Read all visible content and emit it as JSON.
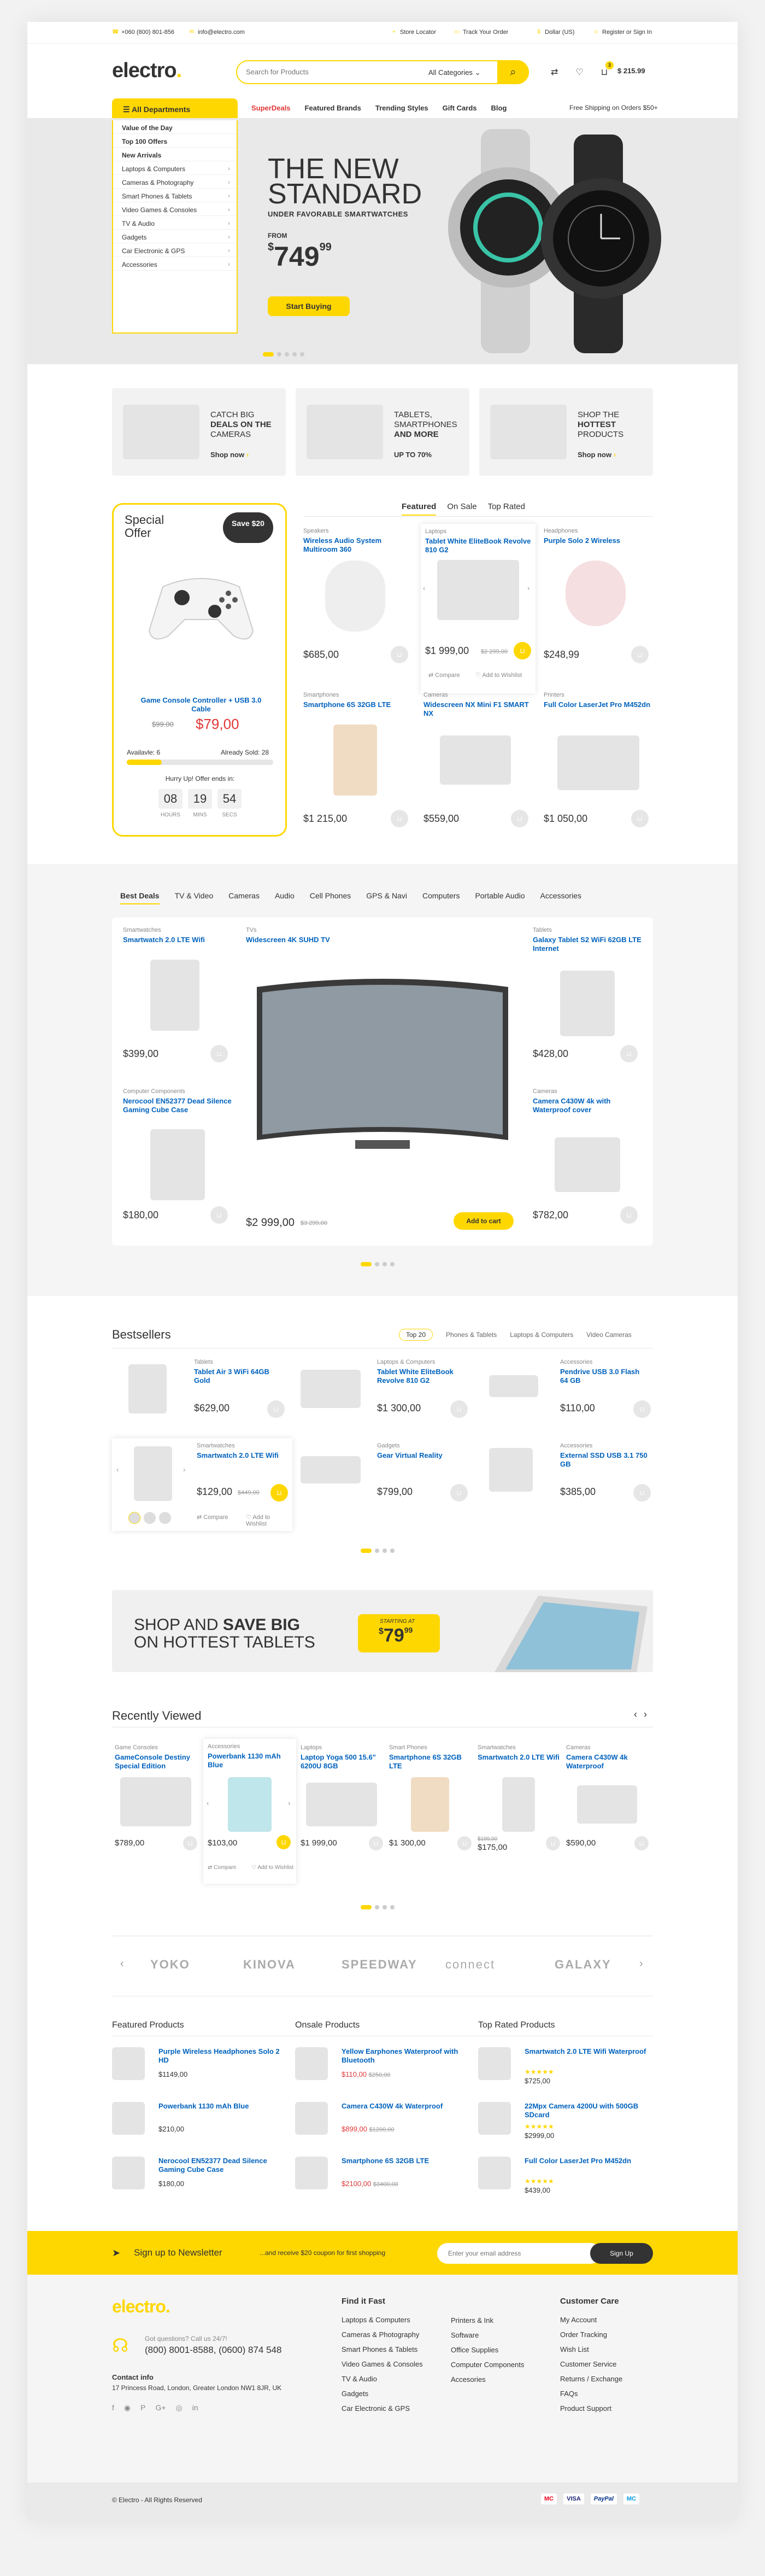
{
  "topbar": {
    "phone": "+060 (800) 801-856",
    "email": "info@electro.com",
    "store_locator": "Store Locator",
    "track_order": "Track Your Order",
    "currency": "Dollar (US)",
    "register": "Register or Sign In"
  },
  "header": {
    "logo": "electro",
    "search_placeholder": "Search for Products",
    "search_category": "All Categories",
    "cart_count": "3",
    "cart_total": "$ 215.99"
  },
  "nav": {
    "all_departments": "All Departments",
    "items": [
      "SuperDeals",
      "Featured Brands",
      "Trending Styles",
      "Gift Cards",
      "Blog"
    ],
    "free_shipping": "Free Shipping on Orders $50+"
  },
  "categories": [
    "Value of the Day",
    "Top 100 Offers",
    "New Arrivals",
    "Laptops & Computers",
    "Cameras & Photography",
    "Smart Phones & Tablets",
    "Video Games & Consoles",
    "TV & Audio",
    "Gadgets",
    "Car Electronic & GPS",
    "Accessories"
  ],
  "hero": {
    "title1": "THE NEW",
    "title2": "STANDARD",
    "subtitle": "UNDER FAVORABLE SMARTWATCHES",
    "from": "FROM",
    "price": "749",
    "price_cents": "99",
    "button": "Start Buying"
  },
  "promos": [
    {
      "l1": "CATCH BIG",
      "l2": "DEALS ON THE",
      "l3": "CAMERAS",
      "shop": "Shop now"
    },
    {
      "l1": "TABLETS,",
      "l2": "SMARTPHONES",
      "l3": "AND MORE",
      "shop": "UP TO 70%"
    },
    {
      "l1": "SHOP THE",
      "l2": "HOTTEST",
      "l3": "PRODUCTS",
      "shop": "Shop now"
    }
  ],
  "special": {
    "title": "Special Offer",
    "save": "Save $20",
    "name": "Game Console Controller + USB 3.0 Cable",
    "old_price": "$99.00",
    "price": "$79,00",
    "available": "Availavle: 6",
    "sold": "Already Sold: 28",
    "hurry": "Hurry Up! Offer ends in:",
    "hours": "08",
    "mins": "19",
    "secs": "54",
    "hours_l": "HOURS",
    "mins_l": "MINS",
    "secs_l": "SECS"
  },
  "featured_tabs": [
    "Featured",
    "On Sale",
    "Top Rated"
  ],
  "featured": [
    {
      "cat": "Speakers",
      "name": "Wireless Audio System Multiroom 360",
      "price": "$685,00"
    },
    {
      "cat": "Laptops",
      "name": "Tablet White EliteBook Revolve 810 G2",
      "price": "$1 999,00",
      "old": "$2 299,00"
    },
    {
      "cat": "Headphones",
      "name": "Purple Solo 2 Wireless",
      "price": "$248,99"
    },
    {
      "cat": "Smartphones",
      "name": "Smartphone 6S 32GB LTE",
      "price": "$1 215,00"
    },
    {
      "cat": "Cameras",
      "name": "Widescreen NX Mini F1 SMART NX",
      "price": "$559,00"
    },
    {
      "cat": "Printers",
      "name": "Full Color LaserJet Pro M452dn",
      "price": "$1 050,00"
    }
  ],
  "compare": "Compare",
  "wishlist": "Add to Wishlist",
  "deal_tabs": [
    "Best Deals",
    "TV & Video",
    "Cameras",
    "Audio",
    "Cell Phones",
    "GPS & Navi",
    "Computers",
    "Portable Audio",
    "Accessories"
  ],
  "deals": [
    {
      "cat": "Smartwatches",
      "name": "Smartwatch 2.0 LTE Wifi",
      "price": "$399,00"
    },
    {
      "cat": "TVs",
      "name": "Widescreen 4K SUHD TV",
      "price": "$2 999,00",
      "old": "$3 299,00",
      "btn": "Add to cart"
    },
    {
      "cat": "Tablets",
      "name": "Galaxy Tablet S2 WiFi 62GB LTE Internet",
      "price": "$428,00"
    },
    {
      "cat": "Computer Components",
      "name": "Nerocool EN52377 Dead Silence Gaming Cube Case",
      "price": "$180,00"
    },
    {
      "cat": "Cameras",
      "name": "Camera C430W 4k with Waterproof cover",
      "price": "$782,00"
    }
  ],
  "bestsellers": {
    "title": "Bestsellers",
    "tabs": [
      "Top 20",
      "Phones & Tablets",
      "Laptops & Computers",
      "Video Cameras"
    ],
    "items": [
      {
        "cat": "Tablets",
        "name": "Tablet Air 3 WiFi 64GB Gold",
        "price": "$629,00"
      },
      {
        "cat": "Laptops & Computers",
        "name": "Tablet White EliteBook Revolve 810 G2",
        "price": "$1 300,00"
      },
      {
        "cat": "Accessories",
        "name": "Pendrive USB 3.0 Flash 64 GB",
        "price": "$110,00"
      },
      {
        "cat": "Smartwatches",
        "name": "Smartwatch 2.0 LTE Wifi",
        "price": "$129,00",
        "old": "$449,00"
      },
      {
        "cat": "Gadgets",
        "name": "Gear Virtual Reality",
        "price": "$799,00"
      },
      {
        "cat": "Accessories",
        "name": "External SSD USB 3.1 750 GB",
        "price": "$385,00"
      }
    ]
  },
  "banner": {
    "l1a": "SHOP AND ",
    "l1b": "SAVE BIG",
    "l2": "ON HOTTEST TABLETS",
    "starting": "STARTING AT",
    "price": "79",
    "cents": "99"
  },
  "recently": {
    "title": "Recently Viewed",
    "items": [
      {
        "cat": "Game Consoles",
        "name": "GameConsole Destiny Special Edition",
        "price": "$789,00"
      },
      {
        "cat": "Accessories",
        "name": "Powerbank 1130 mAh Blue",
        "price": "$103,00"
      },
      {
        "cat": "Laptops",
        "name": "Laptop Yoga 500 15.6\" 6200U 8GB",
        "price": "$1 999,00"
      },
      {
        "cat": "Smart Phones",
        "name": "Smartphone 6S 32GB LTE",
        "price": "$1 300,00"
      },
      {
        "cat": "Smartwatches",
        "name": "Smartwatch 2.0 LTE Wifi",
        "price": "$175,00",
        "old": "$199,00"
      },
      {
        "cat": "Cameras",
        "name": "Camera C430W 4k Waterproof",
        "price": "$590,00"
      }
    ]
  },
  "brands": [
    "YOKO",
    "KINOVA",
    "SPEEDWAY",
    "connect",
    "GALAXY"
  ],
  "lists": [
    {
      "title": "Featured Products",
      "items": [
        {
          "name": "Purple Wireless Headphones Solo 2 HD",
          "price": "$1149,00"
        },
        {
          "name": "Powerbank 1130 mAh Blue",
          "price": "$210,00"
        },
        {
          "name": "Nerocool EN52377 Dead Silence Gaming Cube Case",
          "price": "$180,00"
        }
      ]
    },
    {
      "title": "Onsale Products",
      "items": [
        {
          "name": "Yellow Earphones Waterproof with Bluetooth",
          "price": "$110,00",
          "old": "$250,00"
        },
        {
          "name": "Camera C430W 4k Waterproof",
          "price": "$899,00",
          "old": "$1200,00"
        },
        {
          "name": "Smartphone 6S 32GB LTE",
          "price": "$2100,00",
          "old": "$3400,00"
        }
      ]
    },
    {
      "title": "Top Rated Products",
      "items": [
        {
          "name": "Smartwatch 2.0 LTE Wifi Waterproof",
          "price": "$725,00"
        },
        {
          "name": "22Mpx Camera 4200U with 500GB SDcard",
          "price": "$2999,00"
        },
        {
          "name": "Full Color LaserJet Pro M452dn",
          "price": "$439,00"
        }
      ]
    }
  ],
  "newsletter": {
    "title": "Sign up to Newsletter",
    "text": "...and receive $20 coupon for first shopping",
    "placeholder": "Enter your email address",
    "button": "Sign Up"
  },
  "footer": {
    "logo": "electro",
    "question": "Got questions? Call us 24/7!",
    "phones": "(800) 8001-8588, (0600) 874 548",
    "contact_title": "Contact info",
    "address": "17 Princess Road, London, Greater London NW1 8JR, UK",
    "find_title": "Find it Fast",
    "find_col1": [
      "Laptops & Computers",
      "Cameras & Photography",
      "Smart Phones & Tablets",
      "Video Games & Consoles",
      "TV & Audio",
      "Gadgets",
      "Car Electronic & GPS"
    ],
    "find_col2": [
      "Printers & Ink",
      "Software",
      "Office Supplies",
      "Computer Components",
      "Accesories"
    ],
    "care_title": "Customer Care",
    "care": [
      "My Account",
      "Order Tracking",
      "Wish List",
      "Customer Service",
      "Returns / Exchange",
      "FAQs",
      "Product Support"
    ],
    "copyright": "© Electro - All Rights Reserved",
    "payments": [
      "MC",
      "VISA",
      "PayPal",
      "MC"
    ]
  }
}
